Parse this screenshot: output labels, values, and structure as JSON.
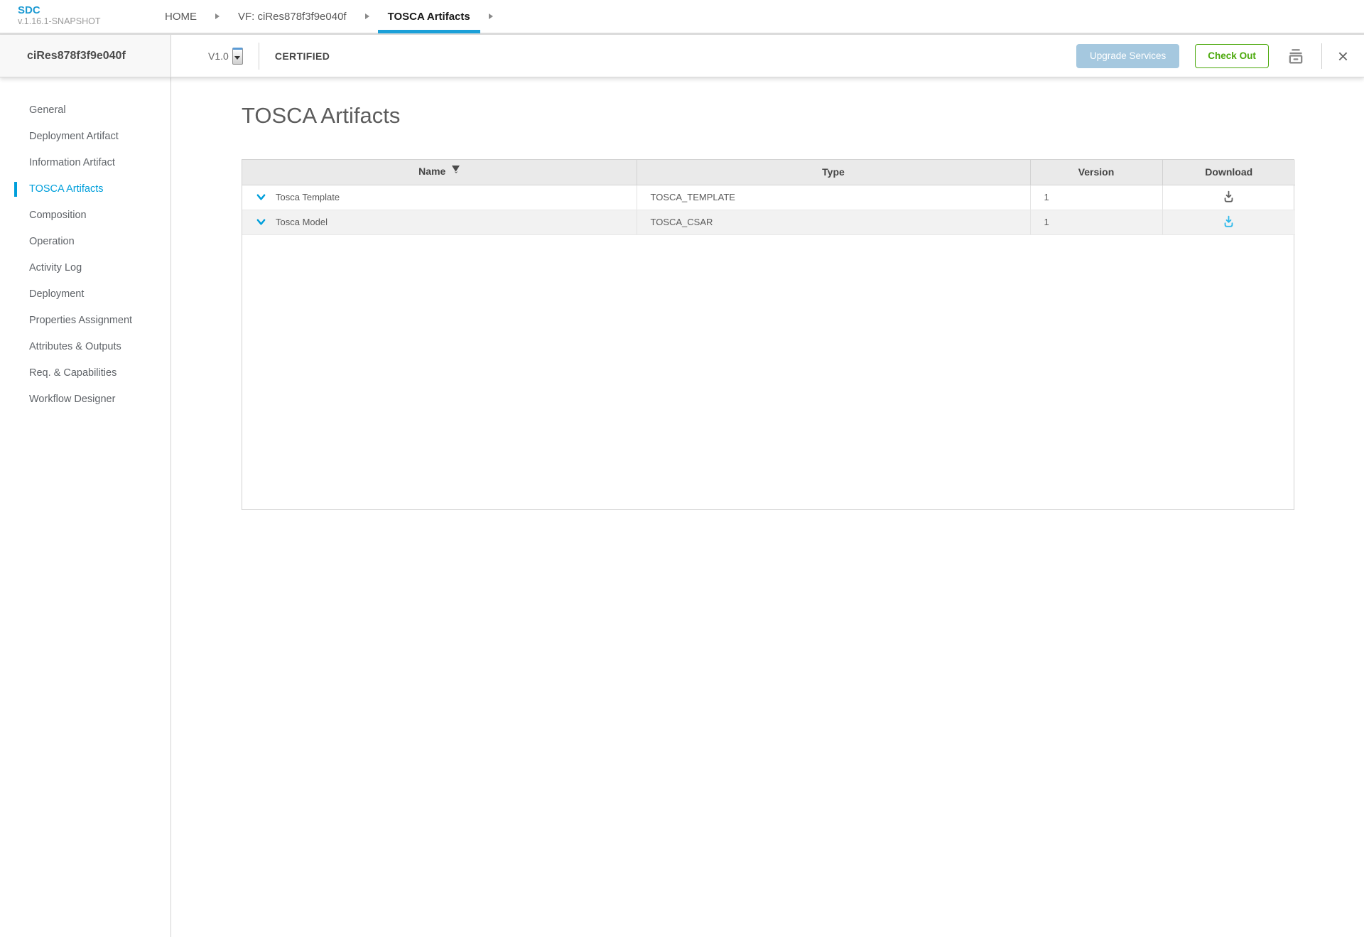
{
  "app": {
    "name": "SDC",
    "version": "v.1.16.1-SNAPSHOT"
  },
  "breadcrumbs": [
    {
      "label": "HOME",
      "active": false
    },
    {
      "label": "VF: ciRes878f3f9e040f",
      "active": false
    },
    {
      "label": "TOSCA Artifacts",
      "active": true
    }
  ],
  "header": {
    "entity_name": "ciRes878f3f9e040f",
    "version": "V1.0",
    "status": "CERTIFIED",
    "upgrade_label": "Upgrade Services",
    "checkout_label": "Check Out"
  },
  "sidebar": {
    "items": [
      {
        "label": "General",
        "active": false
      },
      {
        "label": "Deployment Artifact",
        "active": false
      },
      {
        "label": "Information Artifact",
        "active": false
      },
      {
        "label": "TOSCA Artifacts",
        "active": true
      },
      {
        "label": "Composition",
        "active": false
      },
      {
        "label": "Operation",
        "active": false
      },
      {
        "label": "Activity Log",
        "active": false
      },
      {
        "label": "Deployment",
        "active": false
      },
      {
        "label": "Properties Assignment",
        "active": false
      },
      {
        "label": "Attributes & Outputs",
        "active": false
      },
      {
        "label": "Req. & Capabilities",
        "active": false
      },
      {
        "label": "Workflow Designer",
        "active": false
      }
    ]
  },
  "main": {
    "title": "TOSCA Artifacts",
    "table": {
      "columns": [
        "Name",
        "Type",
        "Version",
        "Download"
      ],
      "rows": [
        {
          "name": "Tosca Template",
          "type": "TOSCA_TEMPLATE",
          "version": "1"
        },
        {
          "name": "Tosca Model",
          "type": "TOSCA_CSAR",
          "version": "1"
        }
      ]
    }
  },
  "icons": {
    "breadcrumb_separator": "right-triangle",
    "sort": "trapezoid-with-chevron",
    "row_expand": "chevron-down",
    "download_row1_color": "#5f5f5f",
    "download_row2_color": "#2cb8ea",
    "print": "printer",
    "close": "x"
  },
  "colors": {
    "accent_blue": "#009fdb",
    "tab_underline": "#1ba0d8",
    "checkout_green": "#4ca90c",
    "upgrade_disabled_blue": "#a5c8df"
  }
}
